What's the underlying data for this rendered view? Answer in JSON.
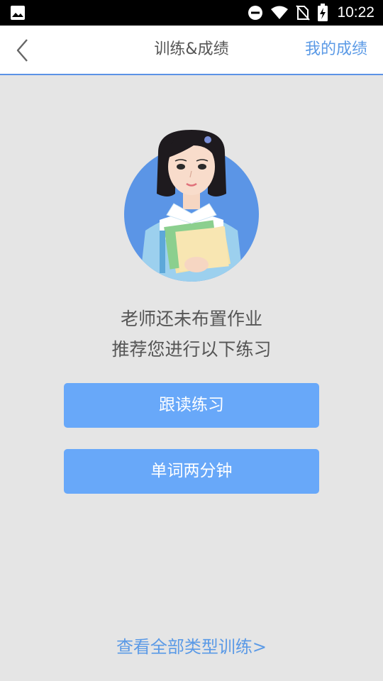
{
  "status_bar": {
    "time": "10:22",
    "icons": [
      "image-icon",
      "dnd-icon",
      "wifi-icon",
      "no-sim-icon",
      "battery-charging-icon"
    ]
  },
  "header": {
    "back_icon": "chevron-left-icon",
    "title": "训练&成绩",
    "right_link": "我的成绩"
  },
  "main": {
    "message_line1": "老师还未布置作业",
    "message_line2": "推荐您进行以下练习",
    "buttons": [
      {
        "label": "跟读练习"
      },
      {
        "label": "单词两分钟"
      }
    ],
    "view_all": "查看全部类型训练>"
  },
  "colors": {
    "accent": "#5b9ae6",
    "button": "#68a8f9",
    "background": "#e5e5e5",
    "header_border": "#5b93e6"
  }
}
